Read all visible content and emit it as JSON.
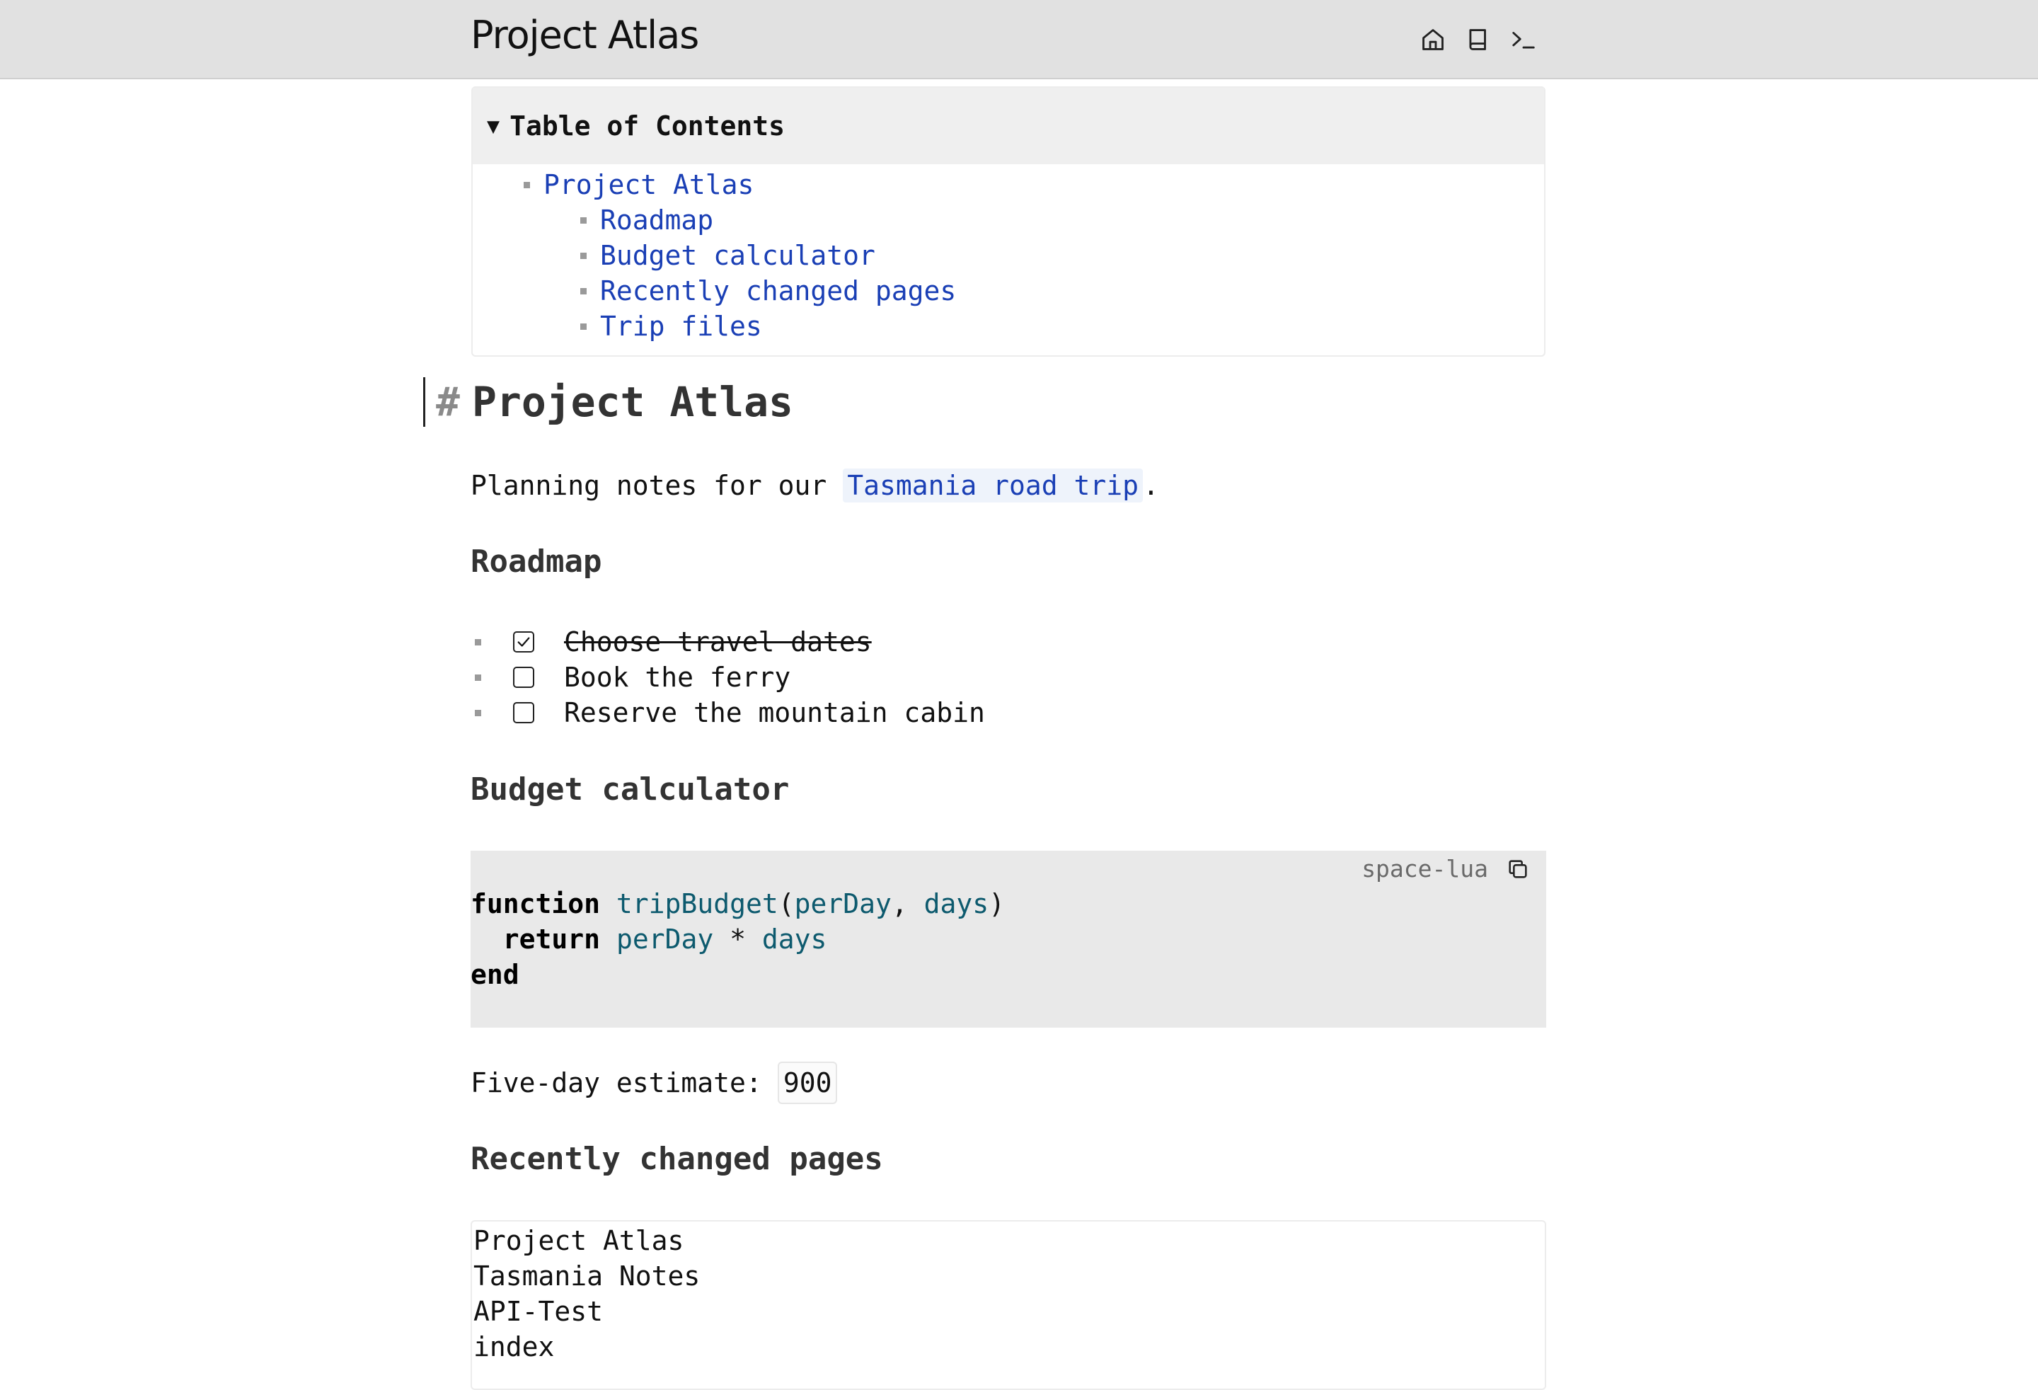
{
  "header": {
    "page_name": "Project Atlas",
    "actions": [
      {
        "name": "home-icon",
        "title": "Home"
      },
      {
        "name": "book-icon",
        "title": "Pages"
      },
      {
        "name": "terminal-icon",
        "title": "Commands"
      }
    ]
  },
  "toc": {
    "title": "Table of Contents",
    "items": [
      {
        "label": "Project Atlas",
        "level": 1
      },
      {
        "label": "Roadmap",
        "level": 2
      },
      {
        "label": "Budget calculator",
        "level": 2
      },
      {
        "label": "Recently changed pages",
        "level": 2
      },
      {
        "label": "Trip files",
        "level": 2
      }
    ]
  },
  "doc": {
    "hash": "#",
    "title": "Project Atlas",
    "intro_prefix": "Planning notes for our ",
    "intro_link": "Tasmania road trip",
    "intro_suffix": ".",
    "roadmap_heading": "Roadmap",
    "tasks": [
      {
        "label": "Choose travel dates",
        "done": true
      },
      {
        "label": "Book the ferry",
        "done": false
      },
      {
        "label": "Reserve the mountain cabin",
        "done": false
      }
    ],
    "budget_heading": "Budget calculator",
    "code": {
      "language": "space-lua",
      "kw_function": "function",
      "fn_name": "tripBudget",
      "paren_open": "(",
      "arg1": "perDay",
      "comma": ", ",
      "arg2": "days",
      "paren_close": ")",
      "kw_return": "return",
      "ret_a": "perDay",
      "op": " * ",
      "ret_b": "days",
      "kw_end": "end"
    },
    "estimate_label": "Five-day estimate:",
    "estimate_value": "900",
    "recent_heading": "Recently changed pages",
    "recent_pages": [
      "Project Atlas",
      "Tasmania Notes",
      "API-Test",
      "index"
    ]
  },
  "colors": {
    "topbar": "#e1e1e1",
    "link": "#1a3fb5",
    "code_bg": "#e9e9e9"
  }
}
